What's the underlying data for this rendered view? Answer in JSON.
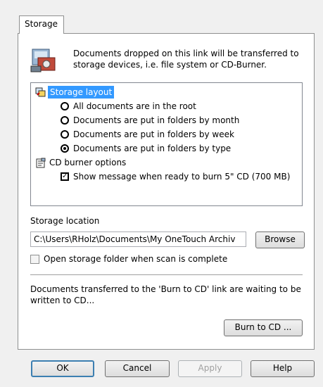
{
  "tab": {
    "label": "Storage"
  },
  "description": "Documents dropped on this link will be transferred to storage devices, i.e. file system or CD-Burner.",
  "tree": {
    "storage_layout": {
      "label": "Storage layout",
      "options": [
        {
          "label": "All documents are in the root",
          "checked": false
        },
        {
          "label": "Documents are put in folders by month",
          "checked": false
        },
        {
          "label": "Documents are put in folders by week",
          "checked": false
        },
        {
          "label": "Documents are put in folders by type",
          "checked": true
        }
      ]
    },
    "cd_burner": {
      "label": "CD burner options",
      "checkbox_label": "Show message when ready to burn 5\" CD (700 MB)",
      "checked": true
    }
  },
  "storage_location": {
    "label": "Storage location",
    "value": "C:\\Users\\RHolz\\Documents\\My OneTouch Archiv",
    "browse_label": "Browse"
  },
  "open_folder": {
    "label": "Open storage folder when scan is complete",
    "checked": false
  },
  "burn_note": "Documents transferred to the 'Burn to CD' link are waiting to be written to CD...",
  "burn_button": "Burn to CD ...",
  "footer": {
    "ok": "OK",
    "cancel": "Cancel",
    "apply": "Apply",
    "help": "Help"
  }
}
